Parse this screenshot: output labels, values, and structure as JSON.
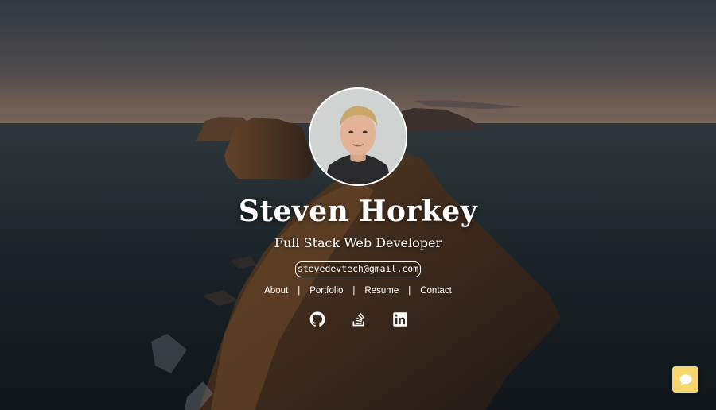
{
  "profile": {
    "name": "Steven Horkey",
    "role": "Full Stack Web Developer",
    "email": "stevedevtech@gmail.com"
  },
  "nav": {
    "about": "About",
    "portfolio": "Portfolio",
    "resume": "Resume",
    "contact": "Contact",
    "separator": "|"
  },
  "social": [
    {
      "icon": "github-icon"
    },
    {
      "icon": "stack-overflow-icon"
    },
    {
      "icon": "linkedin-icon"
    }
  ],
  "chat": {
    "icon": "chat-bubble-icon",
    "color": "#f7d66f"
  }
}
